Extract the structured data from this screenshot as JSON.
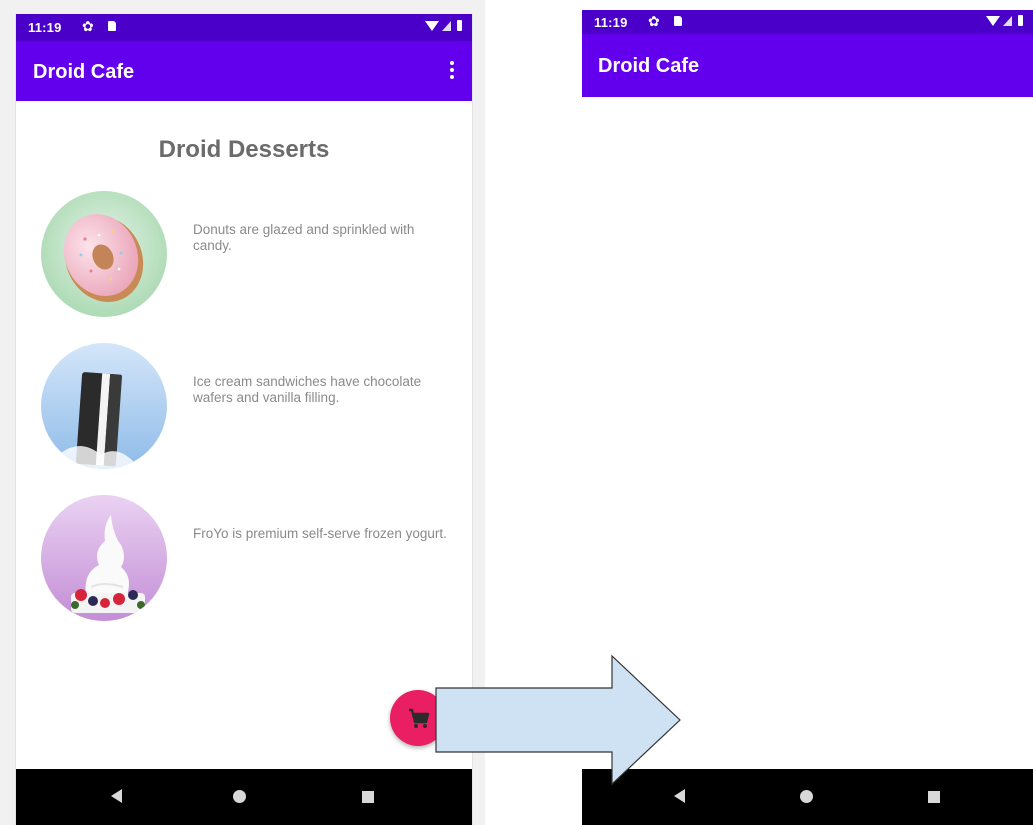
{
  "left_screen": {
    "status_bar": {
      "time": "11:19"
    },
    "app_bar": {
      "title": "Droid Cafe"
    },
    "content": {
      "title": "Droid Desserts",
      "items": [
        {
          "description": "Donuts are glazed and sprinkled with candy.",
          "image": "donut"
        },
        {
          "description": "Ice cream sandwiches have chocolate wafers and vanilla filling.",
          "image": "ice-cream-sandwich"
        },
        {
          "description": "FroYo is premium self-serve frozen yogurt.",
          "image": "froyo"
        }
      ]
    },
    "fab": {
      "icon": "shopping-cart-icon"
    }
  },
  "right_screen": {
    "status_bar": {
      "time": "11:19"
    },
    "app_bar": {
      "title": "Droid Cafe"
    }
  },
  "colors": {
    "status_bar": "#4a00c8",
    "app_bar": "#6200ee",
    "fab": "#e91e63",
    "arrow_fill": "#cfe2f3",
    "arrow_stroke": "#333333"
  }
}
